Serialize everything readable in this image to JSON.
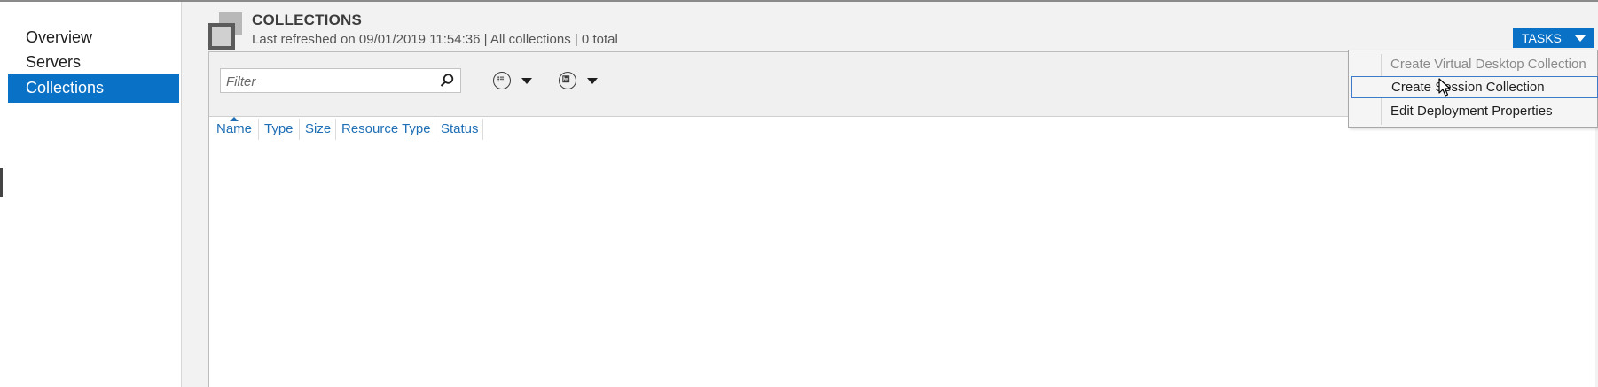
{
  "nav": {
    "items": [
      {
        "label": "Overview",
        "selected": false
      },
      {
        "label": "Servers",
        "selected": false
      },
      {
        "label": "Collections",
        "selected": true
      }
    ]
  },
  "header": {
    "title": "COLLECTIONS",
    "subtitle": "Last refreshed on 09/01/2019 11:54:36 | All collections  | 0 total",
    "icon": "collections-icon"
  },
  "tasks": {
    "label": "TASKS",
    "icon": "chevron-down-icon"
  },
  "toolbar": {
    "filter_placeholder": "Filter",
    "filter_value": "",
    "icons": [
      "search-icon",
      "list-view-icon",
      "save-icon"
    ]
  },
  "table": {
    "columns": [
      "Name",
      "Type",
      "Size",
      "Resource Type",
      "Status"
    ],
    "sorted_by": "Name",
    "rows": []
  },
  "menu": {
    "items": [
      {
        "label": "Create Virtual Desktop Collection",
        "enabled": false
      },
      {
        "label": "Create Session Collection",
        "enabled": true,
        "hovered": true
      },
      {
        "label": "Edit Deployment Properties",
        "enabled": true
      }
    ]
  },
  "colors": {
    "accent": "#0a72c6",
    "link": "#1f6fb5",
    "background": "#f2f2f2"
  }
}
